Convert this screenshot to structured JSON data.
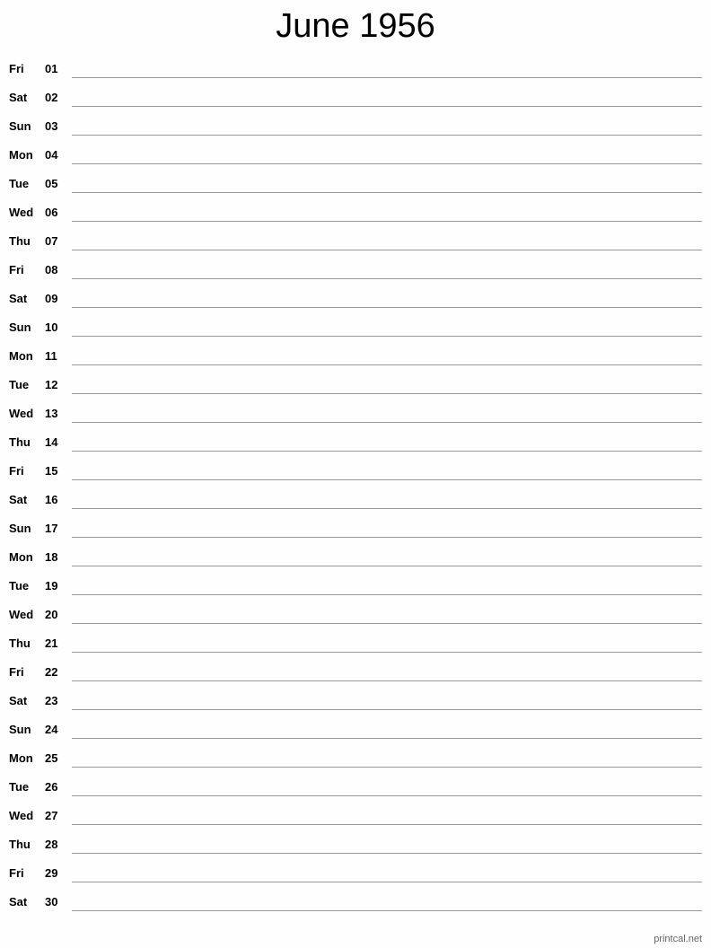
{
  "title": "June 1956",
  "days": [
    {
      "dow": "Fri",
      "date": "01"
    },
    {
      "dow": "Sat",
      "date": "02"
    },
    {
      "dow": "Sun",
      "date": "03"
    },
    {
      "dow": "Mon",
      "date": "04"
    },
    {
      "dow": "Tue",
      "date": "05"
    },
    {
      "dow": "Wed",
      "date": "06"
    },
    {
      "dow": "Thu",
      "date": "07"
    },
    {
      "dow": "Fri",
      "date": "08"
    },
    {
      "dow": "Sat",
      "date": "09"
    },
    {
      "dow": "Sun",
      "date": "10"
    },
    {
      "dow": "Mon",
      "date": "11"
    },
    {
      "dow": "Tue",
      "date": "12"
    },
    {
      "dow": "Wed",
      "date": "13"
    },
    {
      "dow": "Thu",
      "date": "14"
    },
    {
      "dow": "Fri",
      "date": "15"
    },
    {
      "dow": "Sat",
      "date": "16"
    },
    {
      "dow": "Sun",
      "date": "17"
    },
    {
      "dow": "Mon",
      "date": "18"
    },
    {
      "dow": "Tue",
      "date": "19"
    },
    {
      "dow": "Wed",
      "date": "20"
    },
    {
      "dow": "Thu",
      "date": "21"
    },
    {
      "dow": "Fri",
      "date": "22"
    },
    {
      "dow": "Sat",
      "date": "23"
    },
    {
      "dow": "Sun",
      "date": "24"
    },
    {
      "dow": "Mon",
      "date": "25"
    },
    {
      "dow": "Tue",
      "date": "26"
    },
    {
      "dow": "Wed",
      "date": "27"
    },
    {
      "dow": "Thu",
      "date": "28"
    },
    {
      "dow": "Fri",
      "date": "29"
    },
    {
      "dow": "Sat",
      "date": "30"
    }
  ],
  "footer": "printcal.net"
}
